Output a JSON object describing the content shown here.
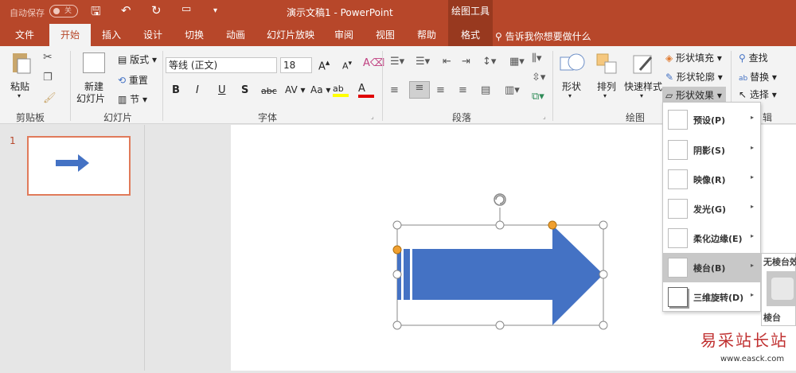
{
  "title_bar": {
    "autosave_label": "自动保存",
    "autosave_state": "关",
    "document_title": "演示文稿1 - PowerPoint",
    "contextual_tool": "绘图工具"
  },
  "tabs": [
    "文件",
    "开始",
    "插入",
    "设计",
    "切换",
    "动画",
    "幻灯片放映",
    "审阅",
    "视图",
    "帮助",
    "格式"
  ],
  "tell_me": "告诉我你想要做什么",
  "ribbon": {
    "clipboard": {
      "paste": "粘贴",
      "group": "剪贴板"
    },
    "slides": {
      "new_slide_line1": "新建",
      "new_slide_line2": "幻灯片",
      "layout": "版式",
      "reset": "重置",
      "section": "节",
      "group": "幻灯片"
    },
    "font": {
      "font_name": "等线 (正文)",
      "font_size": "18",
      "bold": "B",
      "italic": "I",
      "underline": "U",
      "shadow": "S",
      "strike": "abc",
      "spacing": "AV",
      "case": "Aa",
      "group": "字体"
    },
    "paragraph": {
      "group": "段落"
    },
    "drawing": {
      "shapes": "形状",
      "arrange": "排列",
      "quick_styles": "快速样式",
      "fill": "形状填充",
      "outline": "形状轮廓",
      "effects": "形状效果",
      "group": "绘图"
    },
    "editing": {
      "find": "查找",
      "replace": "替换",
      "select": "选择",
      "group_partial": "辑"
    }
  },
  "slide_panel": {
    "slide_number": "1"
  },
  "effects_menu": [
    {
      "label": "预设(P)"
    },
    {
      "label": "阴影(S)"
    },
    {
      "label": "映像(R)"
    },
    {
      "label": "发光(G)"
    },
    {
      "label": "柔化边缘(E)"
    },
    {
      "label": "棱台(B)"
    },
    {
      "label": "三维旋转(D)"
    }
  ],
  "bevel_submenu": {
    "header": "无棱台效",
    "footer": "棱台"
  },
  "watermark": {
    "text": "易采站长站",
    "url": "www.easck.com"
  },
  "colors": {
    "accent": "#b7472a",
    "arrow": "#4472c4",
    "handle_yellow": "#f0a030"
  }
}
